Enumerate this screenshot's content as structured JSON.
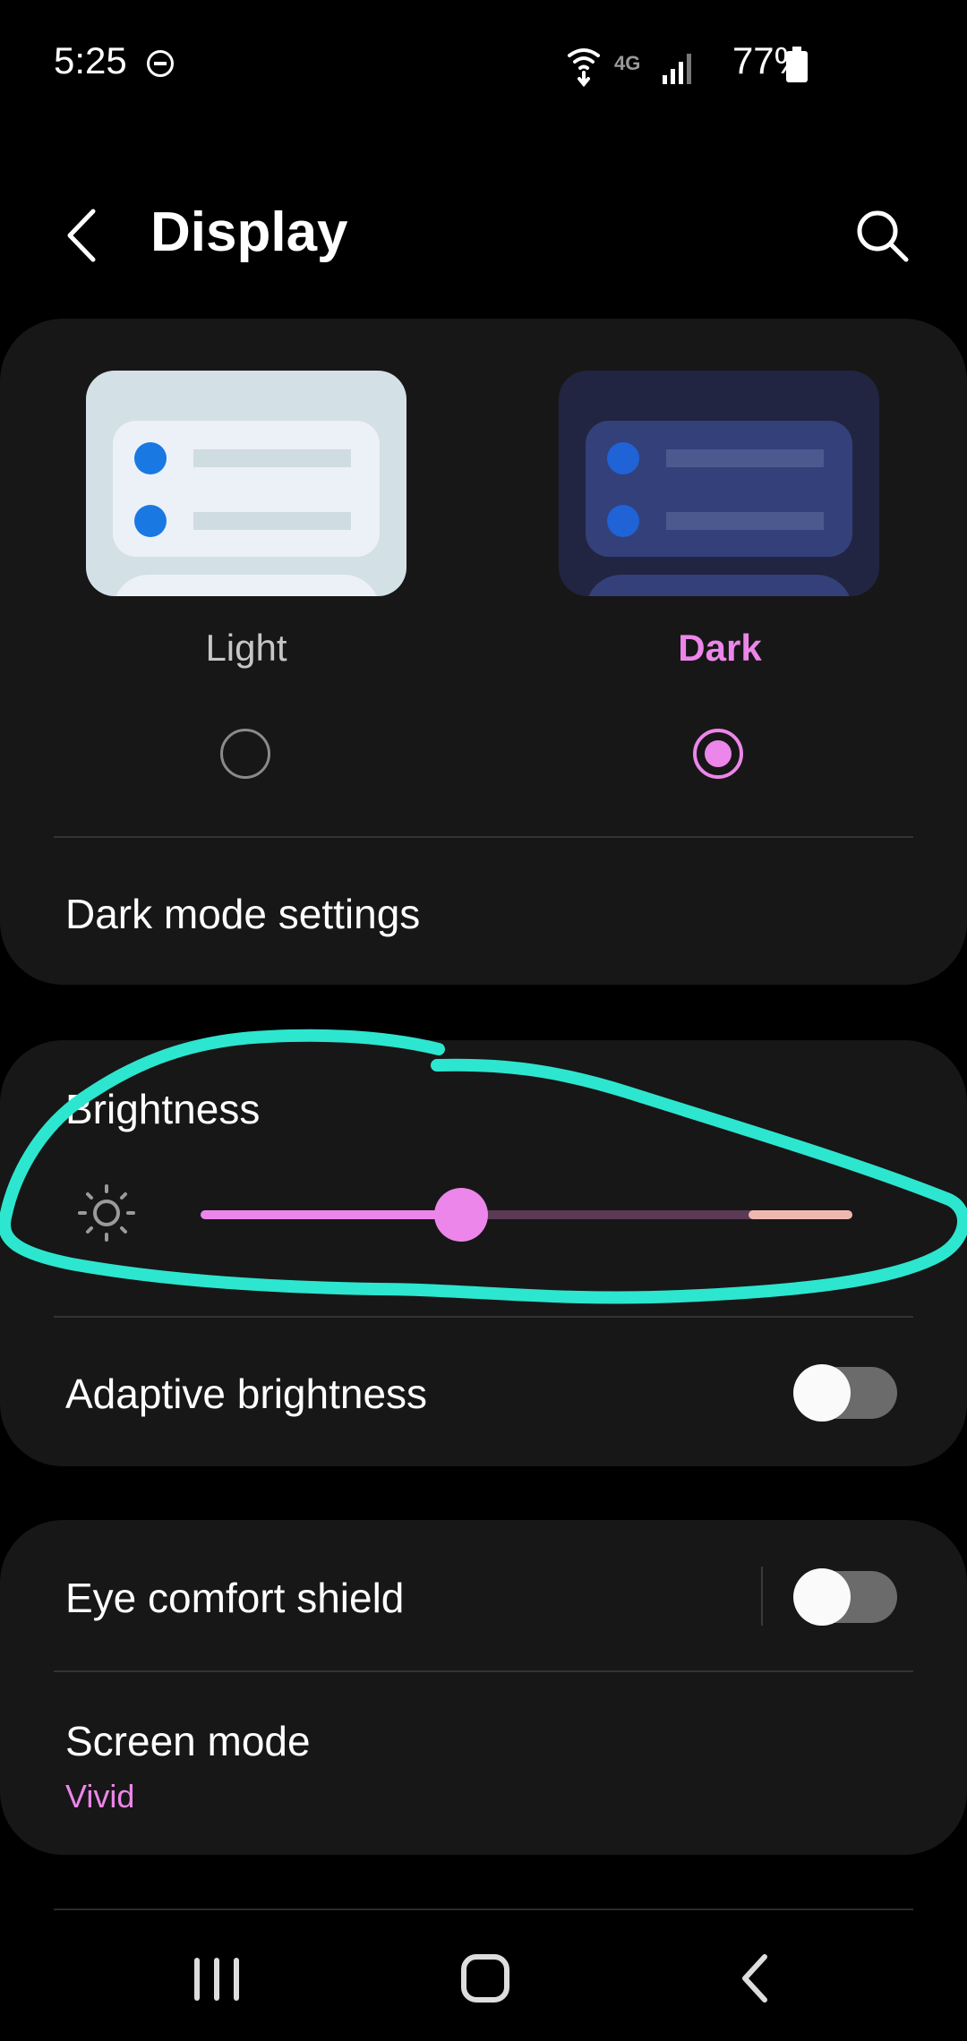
{
  "status_bar": {
    "time": "5:25",
    "battery": "77%",
    "network": "4G"
  },
  "header": {
    "title": "Display"
  },
  "theme": {
    "options": [
      {
        "label": "Light",
        "selected": false
      },
      {
        "label": "Dark",
        "selected": true
      }
    ]
  },
  "rows": {
    "dark_mode_settings": "Dark mode settings",
    "brightness": "Brightness",
    "adaptive_brightness": "Adaptive brightness",
    "eye_comfort_shield": "Eye comfort shield",
    "screen_mode": "Screen mode",
    "screen_mode_value": "Vivid"
  },
  "brightness_level": 0.4,
  "toggles": {
    "adaptive_brightness": false,
    "eye_comfort_shield": false
  },
  "colors": {
    "accent": "#ec86ea",
    "card": "#171717",
    "annotation": "#2de6cf"
  }
}
